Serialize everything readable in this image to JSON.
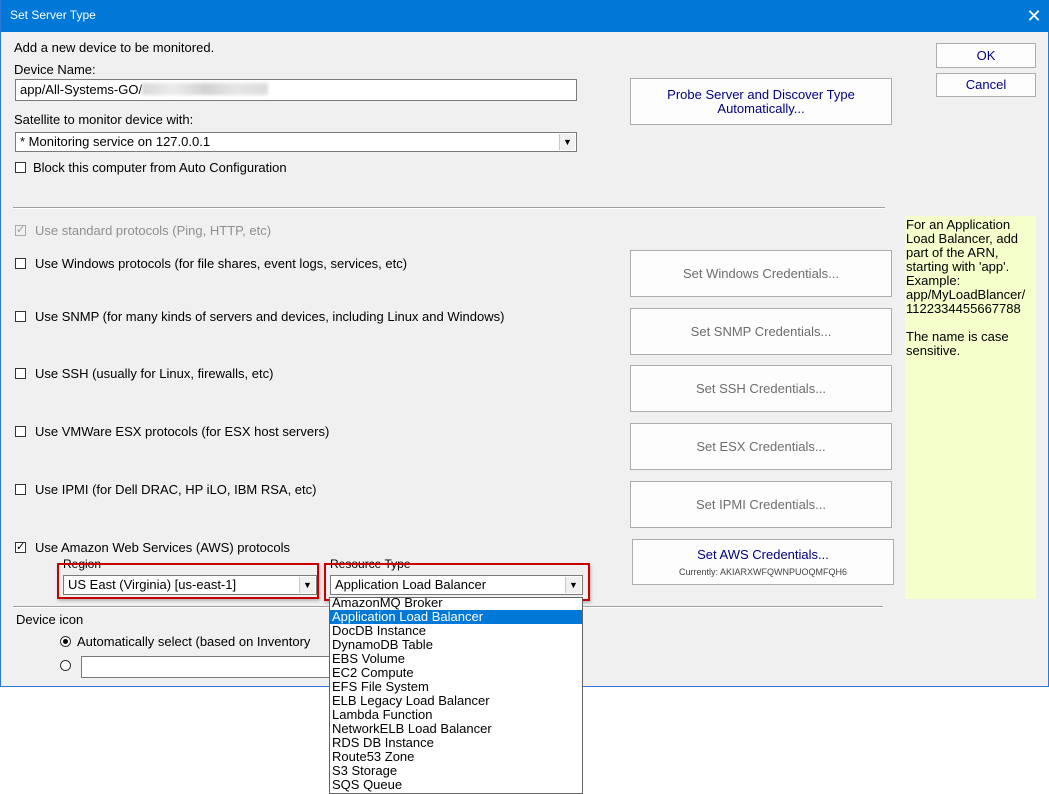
{
  "window": {
    "title": "Set Server Type",
    "close_glyph": "✕"
  },
  "header": {
    "intro": "Add a new device to be monitored.",
    "device_name_label": "Device Name:",
    "device_name_value": "app/All-Systems-GO/",
    "satellite_label": "Satellite to monitor device with:",
    "satellite_value": "* Monitoring service on 127.0.0.1",
    "block_auto_config_label": "Block this computer from Auto Configuration",
    "block_auto_config_checked": false
  },
  "buttons": {
    "ok": "OK",
    "cancel": "Cancel",
    "probe": "Probe Server and Discover Type Automatically..."
  },
  "protocols": {
    "standard": {
      "label": "Use standard protocols (Ping, HTTP, etc)",
      "checked": true,
      "disabled": true
    },
    "windows": {
      "label": "Use Windows protocols (for file shares, event logs, services, etc)",
      "checked": false,
      "button": "Set Windows Credentials..."
    },
    "snmp": {
      "label": "Use SNMP (for many kinds of servers and devices, including Linux and Windows)",
      "checked": false,
      "button": "Set SNMP Credentials..."
    },
    "ssh": {
      "label": "Use SSH (usually for Linux, firewalls, etc)",
      "checked": false,
      "button": "Set SSH Credentials..."
    },
    "esx": {
      "label": "Use VMWare ESX protocols (for ESX host servers)",
      "checked": false,
      "button": "Set ESX Credentials..."
    },
    "ipmi": {
      "label": "Use IPMI (for Dell DRAC, HP iLO, IBM RSA, etc)",
      "checked": false,
      "button": "Set IPMI Credentials..."
    },
    "aws": {
      "label": "Use Amazon Web Services (AWS) protocols",
      "checked": true,
      "button": "Set AWS Credentials...",
      "button_sub": "Currently: AKIARXWFQWNPUOQMFQH6",
      "region_label": "Region",
      "region_value": "US East (Virginia) [us-east-1]",
      "resource_type_label": "Resource Type",
      "resource_type_value": "Application Load Balancer"
    }
  },
  "help_text": {
    "para1": "For an Application Load Balancer, add part of the ARN, starting with 'app'. Example: app/MyLoadBlancer/ 1122334455667788",
    "para2": "The name is case sensitive."
  },
  "device_icon": {
    "label": "Device icon",
    "auto_label": "Automatically select (based on Inventory",
    "auto_selected": true
  },
  "resource_dropdown": {
    "options": [
      "AmazonMQ Broker",
      "Application Load Balancer",
      "DocDB Instance",
      "DynamoDB Table",
      "EBS Volume",
      "EC2 Compute",
      "EFS File System",
      "ELB Legacy Load Balancer",
      "Lambda Function",
      "NetworkELB Load Balancer",
      "RDS DB Instance",
      "Route53 Zone",
      "S3 Storage",
      "SQS Queue"
    ],
    "selected_index": 1
  },
  "colors": {
    "titlebar": "#0078d7",
    "help_background": "#f4ffcc",
    "highlight_box": "#c80000",
    "selection": "#0078d7"
  }
}
